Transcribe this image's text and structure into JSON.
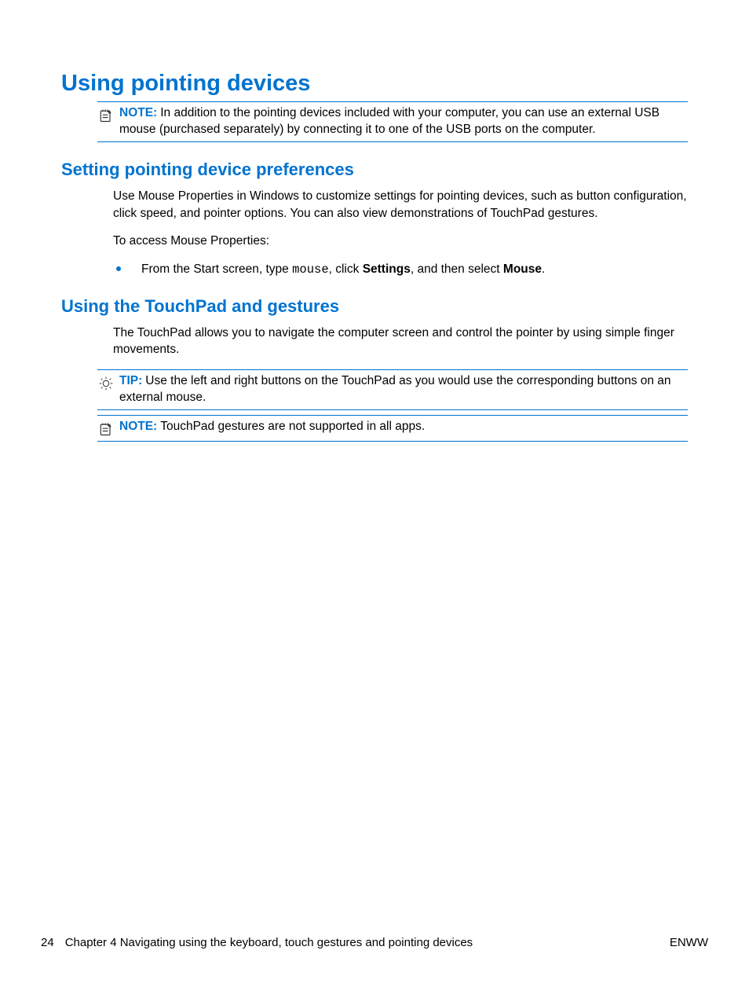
{
  "h1": "Using pointing devices",
  "note1": {
    "label": "NOTE:",
    "text": "In addition to the pointing devices included with your computer, you can use an external USB mouse (purchased separately) by connecting it to one of the USB ports on the computer."
  },
  "h2a": "Setting pointing device preferences",
  "para1": "Use Mouse Properties in Windows to customize settings for pointing devices, such as button configuration, click speed, and pointer options. You can also view demonstrations of TouchPad gestures.",
  "para2": "To access Mouse Properties:",
  "bullet1": {
    "pre": "From the Start screen, type ",
    "mono": "mouse",
    "mid": ", click ",
    "bold1": "Settings",
    "mid2": ", and then select ",
    "bold2": "Mouse",
    "post": "."
  },
  "h2b": "Using the TouchPad and gestures",
  "para3": "The TouchPad allows you to navigate the computer screen and control the pointer by using simple finger movements.",
  "tip": {
    "label": "TIP:",
    "text": "Use the left and right buttons on the TouchPad as you would use the corresponding buttons on an external mouse."
  },
  "note2": {
    "label": "NOTE:",
    "text": "TouchPad gestures are not supported in all apps."
  },
  "footer": {
    "page": "24",
    "chapter": "Chapter 4   Navigating using the keyboard, touch gestures and pointing devices",
    "lang": "ENWW"
  }
}
